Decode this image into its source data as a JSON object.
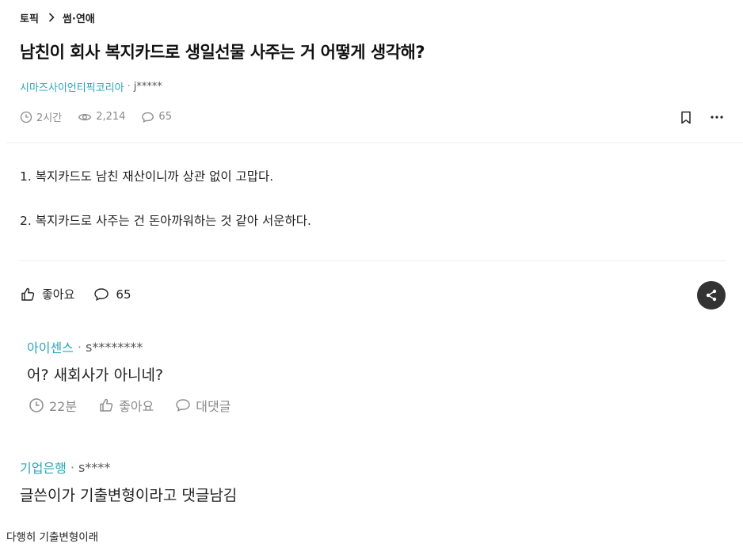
{
  "breadcrumb": {
    "section": "토픽",
    "category": "썸·연애"
  },
  "post": {
    "title": "남친이 회사 복지카드로 생일선물 사주는 거 어떻게 생각해?",
    "company": "시마즈사이언티픽코리아",
    "author": "j*****",
    "time": "2시간",
    "views": "2,214",
    "comments": "65",
    "body": [
      "1. 복지카드도 남친 재산이니까 상관 없이 고맙다.",
      "2. 복지카드로 사주는 건 돈아까워하는 것 같아 서운하다."
    ],
    "like_label": "좋아요",
    "comment_count": "65"
  },
  "comments": [
    {
      "company": "아이센스",
      "author": "s********",
      "text": "어? 새회사가 아니네?",
      "time": "22분",
      "like_label": "좋아요",
      "reply_label": "대댓글"
    },
    {
      "company": "기업은행",
      "author": "s****",
      "text": "글쓴이가 기출변형이라고 댓글남김"
    }
  ],
  "caption": "다행히 기출변형이래",
  "colors": {
    "company": "#2ba3ba",
    "muted": "#8a8a8a",
    "share_bg": "#333333"
  }
}
